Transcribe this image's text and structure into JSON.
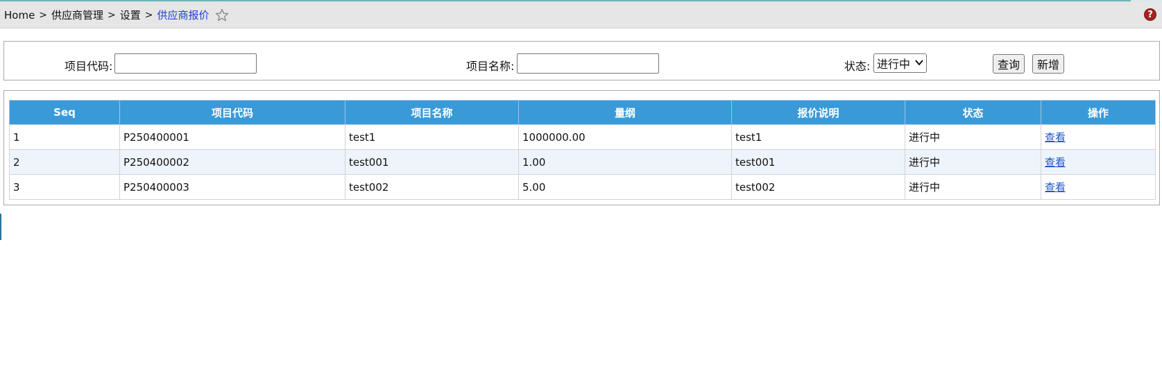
{
  "breadcrumb": {
    "items": [
      "Home",
      "供应商管理",
      "设置"
    ],
    "current": "供应商报价",
    "separator": ">"
  },
  "icons": {
    "favorite": "star-outline-icon",
    "help": "help-icon"
  },
  "help_glyph": "?",
  "filters": {
    "code_label": "项目代码:",
    "code_value": "",
    "name_label": "项目名称:",
    "name_value": "",
    "status_label": "状态:",
    "status_selected": "进行中",
    "search_button": "查询",
    "add_button": "新增"
  },
  "table": {
    "columns": [
      "Seq",
      "项目代码",
      "项目名称",
      "量纲",
      "报价说明",
      "状态",
      "操作"
    ],
    "rows": [
      {
        "seq": "1",
        "code": "P250400001",
        "name": "test1",
        "dimension": "1000000.00",
        "description": "test1",
        "status": "进行中",
        "action": "查看"
      },
      {
        "seq": "2",
        "code": "P250400002",
        "name": "test001",
        "dimension": "1.00",
        "description": "test001",
        "status": "进行中",
        "action": "查看"
      },
      {
        "seq": "3",
        "code": "P250400003",
        "name": "test002",
        "dimension": "5.00",
        "description": "test002",
        "status": "进行中",
        "action": "查看"
      }
    ]
  },
  "colors": {
    "header_bg": "#3a9ad8",
    "breadcrumb_bg": "#e6e6e6",
    "link": "#1f55c7",
    "current_crumb": "#1f3fd6",
    "alt_row": "#eef4fc"
  }
}
